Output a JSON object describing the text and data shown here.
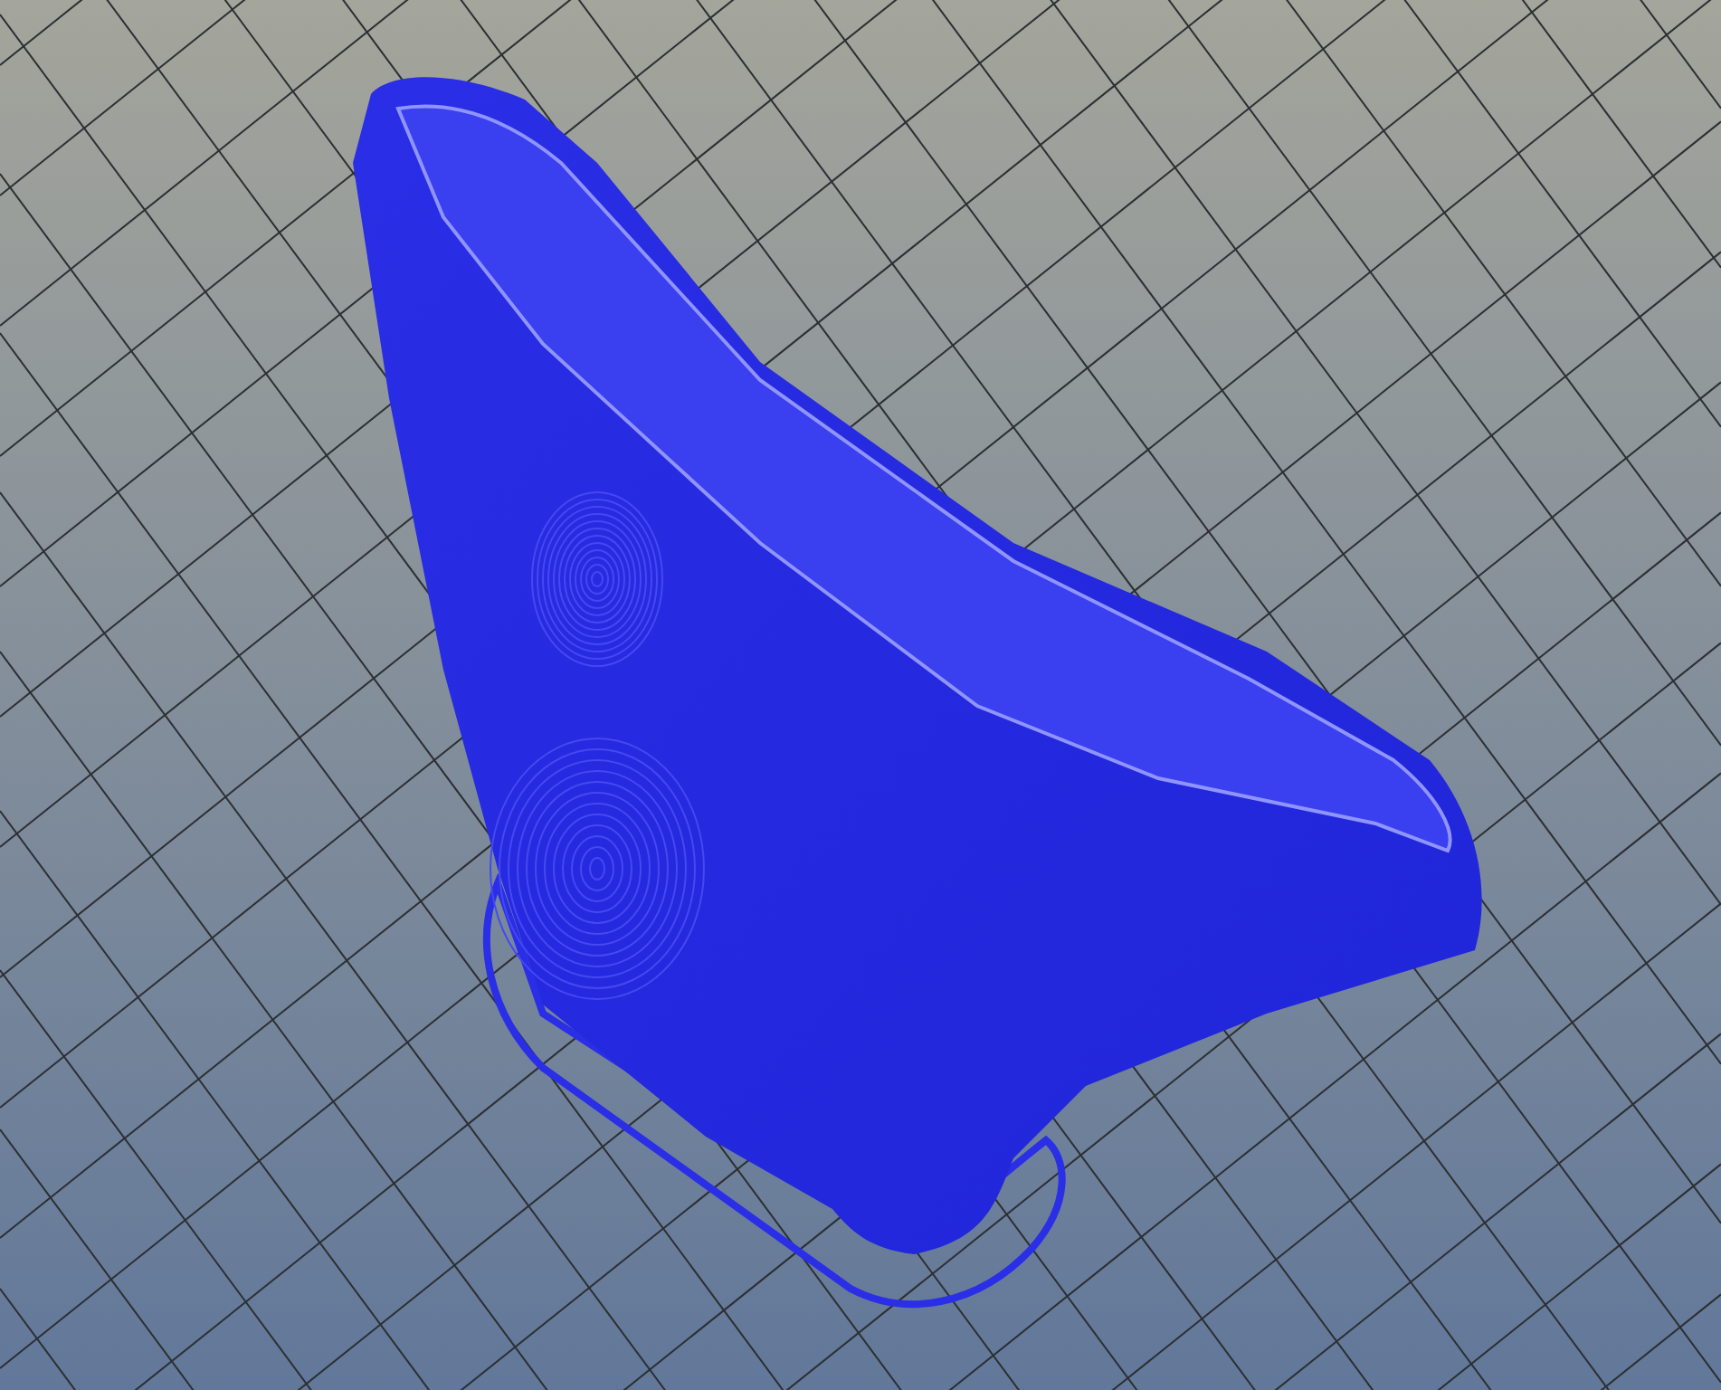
{
  "viewport": {
    "grid": true,
    "skirt": true
  }
}
